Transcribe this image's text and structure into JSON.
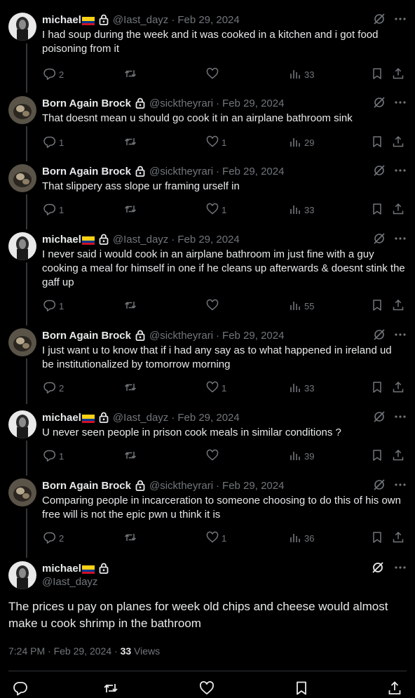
{
  "users": {
    "michael": {
      "name": "michael",
      "handle": "@Iast_dayz"
    },
    "brock": {
      "name": "Born Again Brock",
      "handle": "@sicktheyrari"
    }
  },
  "tweets": [
    {
      "name": "michael",
      "handle": "@Iast_dayz",
      "date": "Feb 29, 2024",
      "text": "I had soup during the week and it was cooked in a kitchen and i got food poisoning from it",
      "replies": "2",
      "likes": "",
      "views": "33"
    },
    {
      "name": "Born Again Brock",
      "handle": "@sicktheyrari",
      "date": "Feb 29, 2024",
      "text": "That doesnt mean u should go cook it in an airplane bathroom sink",
      "replies": "1",
      "likes": "1",
      "views": "29"
    },
    {
      "name": "Born Again Brock",
      "handle": "@sicktheyrari",
      "date": "Feb 29, 2024",
      "text": "That slippery ass slope ur framing urself in",
      "replies": "1",
      "likes": "1",
      "views": "33"
    },
    {
      "name": "michael",
      "handle": "@Iast_dayz",
      "date": "Feb 29, 2024",
      "text": "I never said i would cook in an airplane bathroom im just fine with a guy cooking a meal for himself in one if he cleans up afterwards & doesnt stink the gaff up",
      "replies": "1",
      "likes": "",
      "views": "55"
    },
    {
      "name": "Born Again Brock",
      "handle": "@sicktheyrari",
      "date": "Feb 29, 2024",
      "text": "I just want u to know that if i had any say as to what happened in ireland ud be institutionalized by tomorrow morning",
      "replies": "2",
      "likes": "1",
      "views": "33"
    },
    {
      "name": "michael",
      "handle": "@Iast_dayz",
      "date": "Feb 29, 2024",
      "text": "U never seen people in prison cook meals in similar conditions ?",
      "replies": "1",
      "likes": "",
      "views": "39"
    },
    {
      "name": "Born Again Brock",
      "handle": "@sicktheyrari",
      "date": "Feb 29, 2024",
      "text": "Comparing people in incarceration to someone choosing to do this of his own free will is not the epic pwn u think it is",
      "replies": "2",
      "likes": "1",
      "views": "36"
    }
  ],
  "main_tweet": {
    "name": "michael",
    "handle": "@Iast_dayz",
    "text": "The prices u pay on planes for week old chips and cheese would almost make u cook shrimp in the bathroom",
    "time": "7:24 PM",
    "dot": "·",
    "date": "Feb 29, 2024",
    "views_count": "33",
    "views_label": "Views"
  },
  "separator": "·",
  "colors": {
    "background": "#000000",
    "text": "#e7e9ea",
    "muted": "#71767b",
    "thread_line": "#333639"
  },
  "icons": [
    "lock-icon",
    "flag-icon",
    "grok-icon",
    "more-icon",
    "reply-icon",
    "retweet-icon",
    "like-icon",
    "views-icon",
    "bookmark-icon",
    "share-icon"
  ]
}
